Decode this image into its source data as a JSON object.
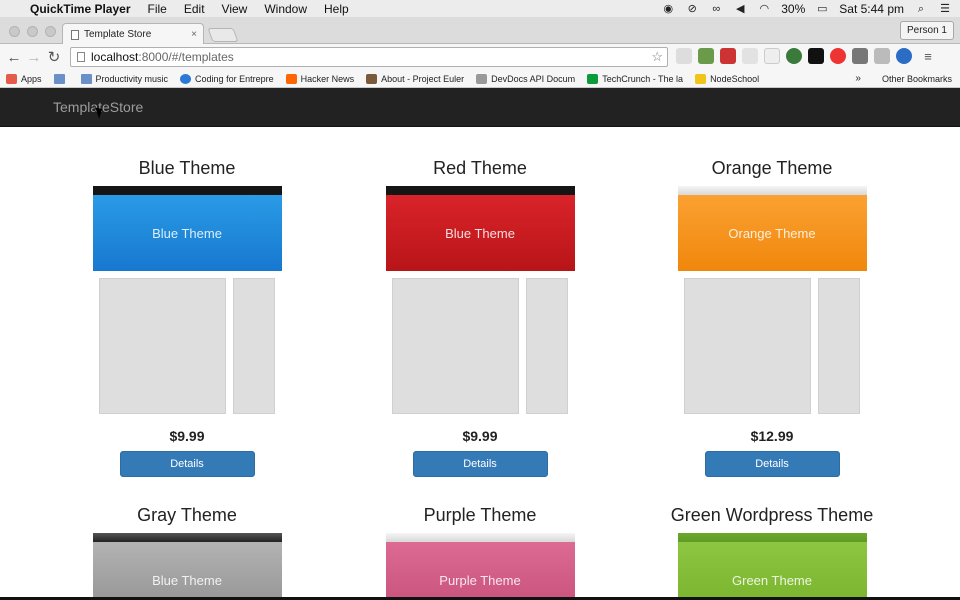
{
  "menubar": {
    "app": "QuickTime Player",
    "items": [
      "File",
      "Edit",
      "View",
      "Window",
      "Help"
    ],
    "battery": "30%",
    "clock": "Sat 5:44 pm"
  },
  "browser": {
    "tab_title": "Template Store",
    "tab_close": "×",
    "person": "Person 1",
    "url_host": "localhost",
    "url_path": ":8000/#/templates",
    "bookmarks": [
      {
        "label": "Apps",
        "icon": "apps-grid-icon",
        "color": "#e65a4b"
      },
      {
        "label": "",
        "icon": "folder-icon",
        "color": "#6b8fc7"
      },
      {
        "label": "Productivity music",
        "icon": "folder-icon",
        "color": "#6b8fc7"
      },
      {
        "label": "Coding for Entrepre",
        "icon": "globe-icon",
        "color": "#2a7ad6"
      },
      {
        "label": "Hacker News",
        "icon": "y-icon",
        "color": "#ff6600"
      },
      {
        "label": "About - Project Euler",
        "icon": "pe-icon",
        "color": "#7a5a3a"
      },
      {
        "label": "DevDocs API Docum",
        "icon": "devdocs-icon",
        "color": "#999999"
      },
      {
        "label": "TechCrunch - The la",
        "icon": "tc-icon",
        "color": "#0a9b3a"
      },
      {
        "label": "NodeSchool",
        "icon": "nodeschool-icon",
        "color": "#f0c419"
      }
    ],
    "bookmarks_more": "»",
    "other_bookmarks": "Other Bookmarks"
  },
  "site": {
    "brand": "TemplateStore",
    "details_label": "Details",
    "templates": [
      {
        "name": "Blue Theme",
        "preview_text": "Blue Theme",
        "price": "$9.99",
        "color": "#2a9be6",
        "color_dark": "#1778cf",
        "strip": "#151515"
      },
      {
        "name": "Red Theme",
        "preview_text": "Blue Theme",
        "price": "$9.99",
        "color": "#d9232a",
        "color_dark": "#b81518",
        "strip": "#151515"
      },
      {
        "name": "Orange Theme",
        "preview_text": "Orange Theme",
        "price": "$12.99",
        "color": "#fba132",
        "color_dark": "#f0870c",
        "strip": "#e9e9e9"
      },
      {
        "name": "Gray Theme",
        "preview_text": "Blue Theme",
        "price": "",
        "color": "#b3b3b3",
        "color_dark": "#8f8f8f",
        "strip": "#333333"
      },
      {
        "name": "Purple Theme",
        "preview_text": "Purple Theme",
        "price": "",
        "color": "#dc6a92",
        "color_dark": "#c54f78",
        "strip": "#e9e9e9"
      },
      {
        "name": "Green Wordpress Theme",
        "preview_text": "Green Theme",
        "price": "",
        "color": "#8dc641",
        "color_dark": "#76b12a",
        "strip": "#5f9a25"
      }
    ]
  }
}
